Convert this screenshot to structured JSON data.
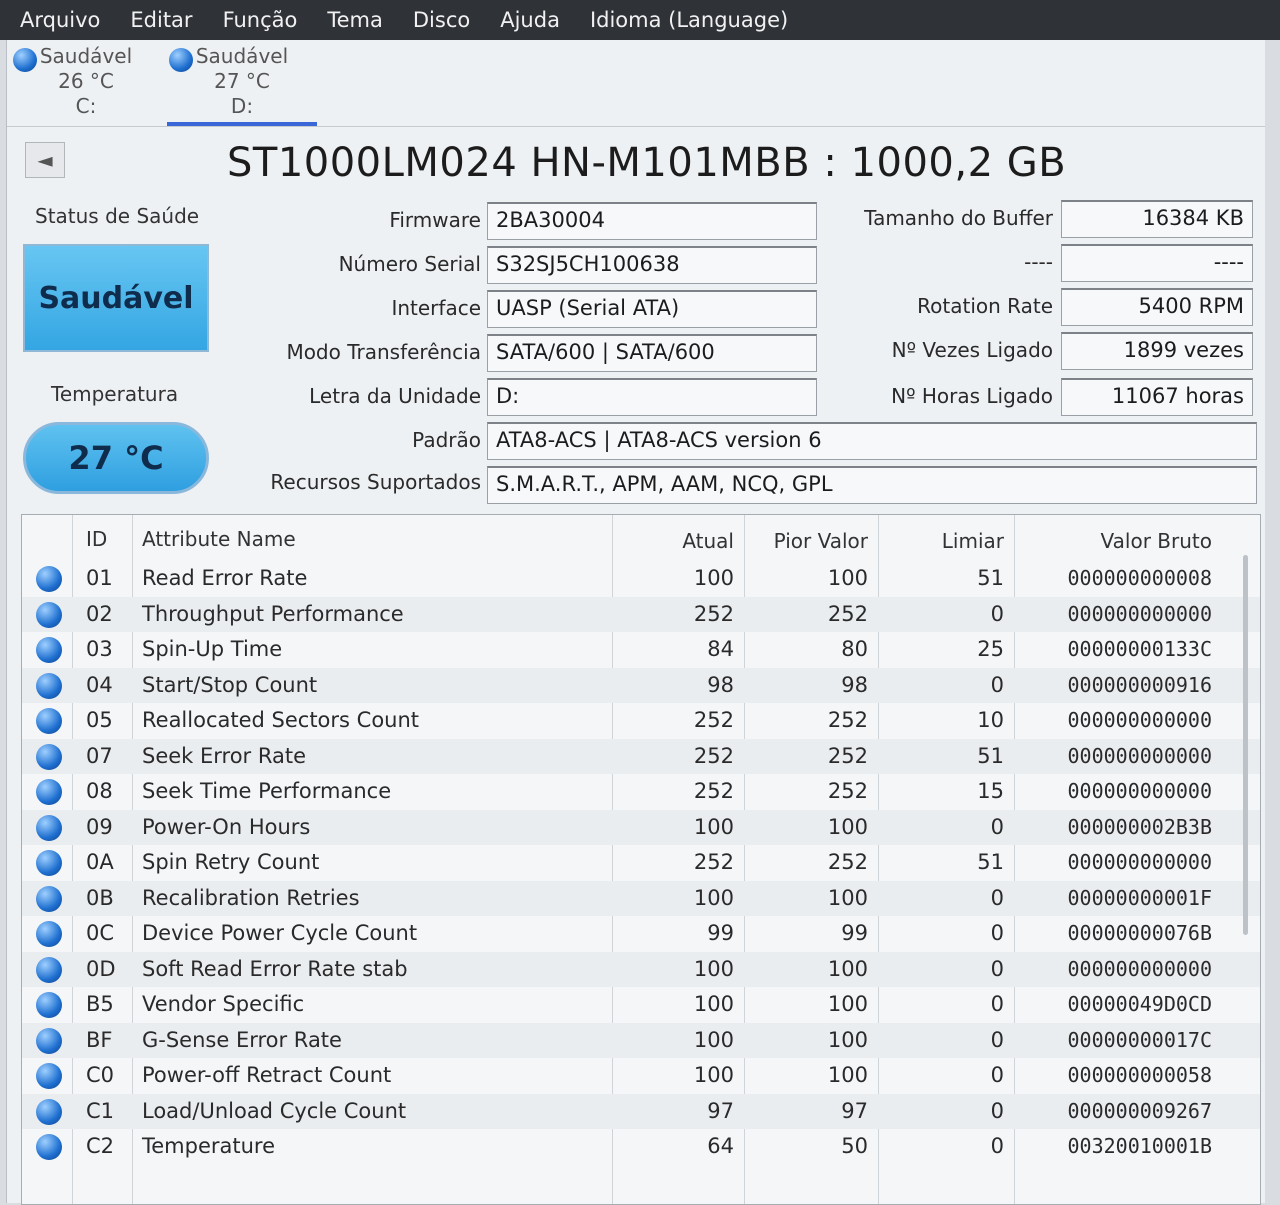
{
  "menu": [
    "Arquivo",
    "Editar",
    "Função",
    "Tema",
    "Disco",
    "Ajuda",
    "Idioma (Language)"
  ],
  "drives": [
    {
      "status": "Saudável",
      "temp": "26 °C",
      "letter": "C:"
    },
    {
      "status": "Saudável",
      "temp": "27 °C",
      "letter": "D:"
    }
  ],
  "back_glyph": "◄",
  "disk_title": "ST1000LM024 HN-M101MBB : 1000,2 GB",
  "health": {
    "label": "Status de Saúde",
    "value": "Saudável"
  },
  "temperature": {
    "label": "Temperatura",
    "value": "27 °C"
  },
  "fields": {
    "firmware": {
      "label": "Firmware",
      "value": "2BA30004"
    },
    "serial": {
      "label": "Número Serial",
      "value": "S32SJ5CH100638"
    },
    "interface": {
      "label": "Interface",
      "value": "UASP (Serial ATA)"
    },
    "transfer": {
      "label": "Modo Transferência",
      "value": "SATA/600 | SATA/600"
    },
    "drive_letter": {
      "label": "Letra da Unidade",
      "value": "D:"
    },
    "standard": {
      "label": "Padrão",
      "value": "ATA8-ACS | ATA8-ACS version 6"
    },
    "features": {
      "label": "Recursos Suportados",
      "value": "S.M.A.R.T., APM, AAM, NCQ, GPL"
    },
    "buffer": {
      "label": "Tamanho do Buffer",
      "value": "16384 KB"
    },
    "unknown": {
      "label": "----",
      "value": "----"
    },
    "rotation": {
      "label": "Rotation Rate",
      "value": "5400 RPM"
    },
    "power_count": {
      "label": "Nº Vezes Ligado",
      "value": "1899 vezes"
    },
    "power_hours": {
      "label": "Nº Horas Ligado",
      "value": "11067 horas"
    }
  },
  "smart": {
    "columns": [
      "ID",
      "Attribute Name",
      "Atual",
      "Pior Valor",
      "Limiar",
      "Valor Bruto"
    ],
    "rows": [
      [
        "01",
        "Read Error Rate",
        "100",
        "100",
        "51",
        "000000000008"
      ],
      [
        "02",
        "Throughput Performance",
        "252",
        "252",
        "0",
        "000000000000"
      ],
      [
        "03",
        "Spin-Up Time",
        "84",
        "80",
        "25",
        "00000000133C"
      ],
      [
        "04",
        "Start/Stop Count",
        "98",
        "98",
        "0",
        "000000000916"
      ],
      [
        "05",
        "Reallocated Sectors Count",
        "252",
        "252",
        "10",
        "000000000000"
      ],
      [
        "07",
        "Seek Error Rate",
        "252",
        "252",
        "51",
        "000000000000"
      ],
      [
        "08",
        "Seek Time Performance",
        "252",
        "252",
        "15",
        "000000000000"
      ],
      [
        "09",
        "Power-On Hours",
        "100",
        "100",
        "0",
        "000000002B3B"
      ],
      [
        "0A",
        "Spin Retry Count",
        "252",
        "252",
        "51",
        "000000000000"
      ],
      [
        "0B",
        "Recalibration Retries",
        "100",
        "100",
        "0",
        "00000000001F"
      ],
      [
        "0C",
        "Device Power Cycle Count",
        "99",
        "99",
        "0",
        "00000000076B"
      ],
      [
        "0D",
        "Soft Read Error Rate stab",
        "100",
        "100",
        "0",
        "000000000000"
      ],
      [
        "B5",
        "Vendor Specific",
        "100",
        "100",
        "0",
        "00000049D0CD"
      ],
      [
        "BF",
        "G-Sense Error Rate",
        "100",
        "100",
        "0",
        "00000000017C"
      ],
      [
        "C0",
        "Power-off Retract Count",
        "100",
        "100",
        "0",
        "000000000058"
      ],
      [
        "C1",
        "Load/Unload Cycle Count",
        "97",
        "97",
        "0",
        "000000009267"
      ],
      [
        "C2",
        "Temperature",
        "64",
        "50",
        "0",
        "00320010001B"
      ]
    ]
  }
}
